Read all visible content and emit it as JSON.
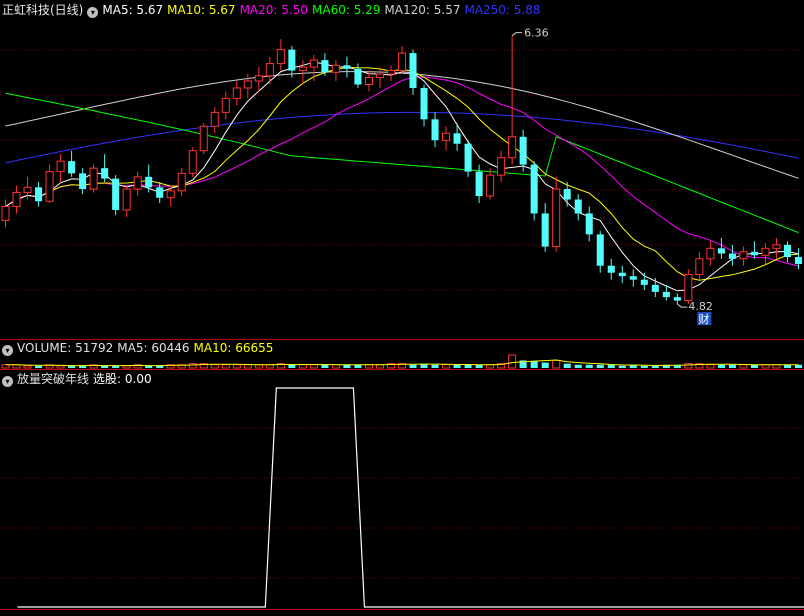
{
  "main_header": {
    "stock_name": "正虹科技(日线)",
    "ma_items": [
      {
        "text": "MA5: 5.67",
        "color": "#ffffff"
      },
      {
        "text": "MA10: 5.67",
        "color": "#ffff00"
      },
      {
        "text": "MA20: 5.50",
        "color": "#ff00ff"
      },
      {
        "text": "MA60: 5.29",
        "color": "#00ff00"
      },
      {
        "text": "MA120: 5.57",
        "color": "#d0d0d0"
      },
      {
        "text": "MA250: 5.88",
        "color": "#3232ff"
      }
    ]
  },
  "volume_header": {
    "items": [
      {
        "text": "VOLUME: 51792",
        "color": "#e0e0e0"
      },
      {
        "text": "MA5: 60446",
        "color": "#e0e0e0"
      },
      {
        "text": "MA10: 66655",
        "color": "#ffff00"
      }
    ]
  },
  "indicator_header": {
    "name": "放量突破年线",
    "value": "选股: 0.00"
  },
  "annotations": {
    "high_label": "6.36",
    "low_label": "4.82",
    "badge": "财"
  },
  "colors": {
    "up": "#ff3232",
    "down": "#54fcfc",
    "grid": "#7a0000",
    "divider": "#c00000",
    "ma5": "#ffffff",
    "ma10": "#ffff00",
    "ma20": "#ff00ff",
    "ma60": "#00ff00",
    "ma120": "#d0d0d0",
    "ma250": "#3232ff"
  },
  "chart_data": [
    {
      "type": "candlestick",
      "ylim": [
        4.7,
        6.45
      ],
      "ohlc": [
        [
          5.3,
          5.42,
          5.26,
          5.38
        ],
        [
          5.38,
          5.5,
          5.34,
          5.46
        ],
        [
          5.46,
          5.55,
          5.42,
          5.49
        ],
        [
          5.49,
          5.52,
          5.38,
          5.41
        ],
        [
          5.41,
          5.62,
          5.4,
          5.58
        ],
        [
          5.58,
          5.68,
          5.52,
          5.64
        ],
        [
          5.64,
          5.7,
          5.55,
          5.57
        ],
        [
          5.57,
          5.6,
          5.45,
          5.48
        ],
        [
          5.48,
          5.62,
          5.46,
          5.6
        ],
        [
          5.6,
          5.68,
          5.52,
          5.54
        ],
        [
          5.54,
          5.56,
          5.33,
          5.36
        ],
        [
          5.36,
          5.5,
          5.32,
          5.48
        ],
        [
          5.48,
          5.58,
          5.44,
          5.55
        ],
        [
          5.55,
          5.62,
          5.46,
          5.49
        ],
        [
          5.49,
          5.52,
          5.4,
          5.43
        ],
        [
          5.43,
          5.5,
          5.38,
          5.47
        ],
        [
          5.47,
          5.6,
          5.44,
          5.57
        ],
        [
          5.57,
          5.72,
          5.55,
          5.7
        ],
        [
          5.7,
          5.86,
          5.68,
          5.84
        ],
        [
          5.84,
          5.95,
          5.8,
          5.92
        ],
        [
          5.92,
          6.04,
          5.88,
          6.0
        ],
        [
          6.0,
          6.1,
          5.96,
          6.06
        ],
        [
          6.06,
          6.14,
          6.0,
          6.1
        ],
        [
          6.1,
          6.18,
          6.04,
          6.13
        ],
        [
          6.13,
          6.24,
          6.08,
          6.2
        ],
        [
          6.2,
          6.34,
          6.16,
          6.28
        ],
        [
          6.28,
          6.3,
          6.12,
          6.16
        ],
        [
          6.16,
          6.22,
          6.08,
          6.18
        ],
        [
          6.18,
          6.25,
          6.1,
          6.22
        ],
        [
          6.22,
          6.26,
          6.13,
          6.15
        ],
        [
          6.15,
          6.22,
          6.1,
          6.19
        ],
        [
          6.19,
          6.24,
          6.12,
          6.17
        ],
        [
          6.17,
          6.2,
          6.06,
          6.08
        ],
        [
          6.08,
          6.16,
          6.04,
          6.12
        ],
        [
          6.12,
          6.18,
          6.06,
          6.14
        ],
        [
          6.14,
          6.19,
          6.1,
          6.16
        ],
        [
          6.16,
          6.3,
          6.14,
          6.26
        ],
        [
          6.26,
          6.28,
          6.02,
          6.06
        ],
        [
          6.06,
          6.08,
          5.84,
          5.88
        ],
        [
          5.88,
          5.92,
          5.72,
          5.76
        ],
        [
          5.76,
          5.84,
          5.7,
          5.8
        ],
        [
          5.8,
          5.86,
          5.7,
          5.74
        ],
        [
          5.74,
          5.76,
          5.55,
          5.58
        ],
        [
          5.58,
          5.62,
          5.4,
          5.44
        ],
        [
          5.44,
          5.6,
          5.42,
          5.56
        ],
        [
          5.56,
          5.7,
          5.52,
          5.66
        ],
        [
          5.66,
          6.36,
          5.62,
          5.78
        ],
        [
          5.78,
          5.82,
          5.58,
          5.62
        ],
        [
          5.62,
          5.64,
          5.3,
          5.34
        ],
        [
          5.34,
          5.4,
          5.12,
          5.15
        ],
        [
          5.15,
          5.55,
          5.12,
          5.48
        ],
        [
          5.48,
          5.52,
          5.38,
          5.42
        ],
        [
          5.42,
          5.45,
          5.3,
          5.34
        ],
        [
          5.34,
          5.38,
          5.18,
          5.22
        ],
        [
          5.22,
          5.24,
          5.0,
          5.04
        ],
        [
          5.04,
          5.08,
          4.96,
          5.0
        ],
        [
          5.0,
          5.04,
          4.94,
          4.98
        ],
        [
          4.98,
          5.02,
          4.92,
          4.96
        ],
        [
          4.96,
          5.0,
          4.9,
          4.93
        ],
        [
          4.93,
          4.97,
          4.86,
          4.89
        ],
        [
          4.89,
          4.93,
          4.84,
          4.86
        ],
        [
          4.86,
          4.88,
          4.82,
          4.84
        ],
        [
          4.84,
          5.02,
          4.82,
          4.99
        ],
        [
          4.99,
          5.12,
          4.96,
          5.08
        ],
        [
          5.08,
          5.18,
          5.04,
          5.14
        ],
        [
          5.14,
          5.2,
          5.08,
          5.11
        ],
        [
          5.11,
          5.16,
          5.04,
          5.08
        ],
        [
          5.08,
          5.15,
          5.04,
          5.12
        ],
        [
          5.12,
          5.18,
          5.08,
          5.1
        ],
        [
          5.1,
          5.17,
          5.05,
          5.14
        ],
        [
          5.14,
          5.2,
          5.08,
          5.16
        ],
        [
          5.16,
          5.18,
          5.06,
          5.09
        ],
        [
          5.09,
          5.14,
          5.02,
          5.05
        ]
      ]
    },
    {
      "type": "bar",
      "series": [
        {
          "name": "VOLUME",
          "values": [
            3,
            3,
            2,
            2,
            3,
            2,
            2,
            2,
            3,
            2,
            2,
            2,
            3,
            2,
            2,
            3,
            3,
            4,
            4,
            3,
            3,
            3,
            3,
            3,
            3,
            4,
            3,
            3,
            3,
            3,
            3,
            3,
            3,
            3,
            3,
            4,
            4,
            3,
            4,
            3,
            3,
            3,
            3,
            3,
            3,
            4,
            12,
            7,
            6,
            5,
            7,
            4,
            3,
            3,
            3,
            3,
            2,
            3,
            2,
            2,
            3,
            3,
            4,
            4,
            3,
            3,
            3,
            3,
            3,
            3,
            3,
            3,
            3
          ]
        }
      ]
    },
    {
      "type": "line",
      "series": [
        {
          "name": "选股",
          "values": [
            0,
            0,
            0,
            0,
            0,
            0,
            0,
            0,
            0,
            0,
            0,
            0,
            0,
            0,
            0,
            0,
            0,
            0,
            0,
            0,
            0,
            0,
            0,
            1,
            1,
            1,
            1,
            1,
            1,
            1,
            1,
            0,
            0,
            0,
            0,
            0,
            0,
            0,
            0,
            0,
            0,
            0,
            0,
            0,
            0,
            0,
            0,
            0,
            0,
            0,
            0,
            0,
            0,
            0,
            0,
            0,
            0,
            0,
            0,
            0,
            0,
            0,
            0,
            0,
            0,
            0,
            0,
            0,
            0,
            0,
            0,
            0,
            0
          ]
        }
      ],
      "ylim": [
        0,
        1
      ]
    }
  ]
}
